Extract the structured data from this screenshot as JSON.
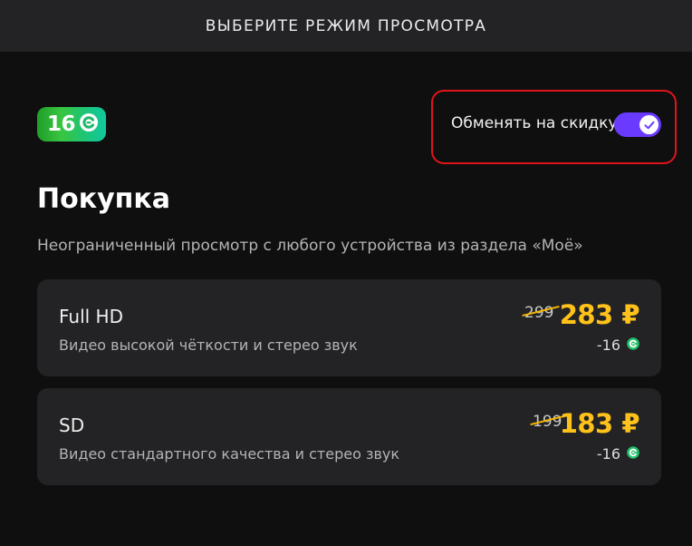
{
  "header": {
    "title": "ВЫБЕРИТЕ РЕЖИМ ПРОСМОТРА"
  },
  "bonus_badge": {
    "value": "16",
    "icon": "bonus-coin-icon"
  },
  "exchange_toggle": {
    "label": "Обменять на скидку",
    "state": "on",
    "accent_color": "#6a3bff",
    "highlight_color": "#e0141a"
  },
  "purchase": {
    "title": "Покупка",
    "description": "Неограниченный просмотр с любого устройства из раздела «Моё»",
    "options": [
      {
        "name": "Full HD",
        "description": "Видео высокой чёткости и стерео звук",
        "old_price": "299",
        "price": "283 ₽",
        "bonus": "-16"
      },
      {
        "name": "SD",
        "description": "Видео стандартного качества и стерео звук",
        "old_price": "199",
        "price": "183 ₽",
        "bonus": "-16"
      }
    ]
  },
  "colors": {
    "price": "#ffc21a",
    "card_bg": "#232325",
    "page_bg": "#0f0f0f"
  }
}
